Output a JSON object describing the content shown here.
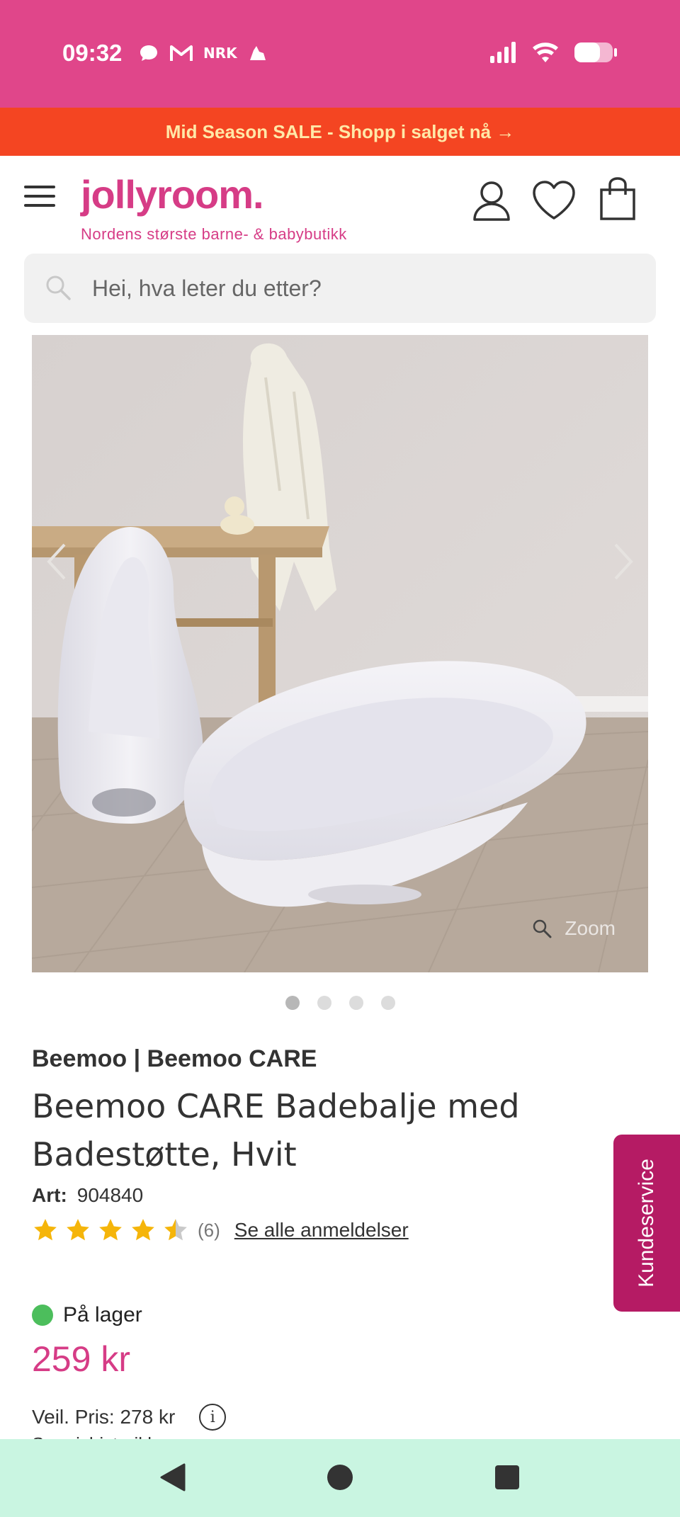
{
  "status_bar": {
    "time": "09:32",
    "notification_icons": [
      "chat-bubble-icon",
      "gmail-icon",
      "nrk-icon",
      "cloud-icon"
    ],
    "nrk_label": "NRK",
    "system_icons": [
      "signal-icon",
      "wifi-icon",
      "battery-icon"
    ]
  },
  "sale_banner": {
    "text": "Mid Season SALE - Shopp i salget nå →"
  },
  "header": {
    "logo": "jollyroom.",
    "tagline": "Nordens største barne- & babybutikk",
    "icons": [
      "menu-icon",
      "account-icon",
      "heart-icon",
      "bag-icon"
    ]
  },
  "search": {
    "placeholder": "Hei, hva leter du etter?"
  },
  "gallery": {
    "zoom_label": "Zoom",
    "current_slide": 1,
    "slide_count": 4
  },
  "product": {
    "brand": "Beemoo | Beemoo CARE",
    "title": "Beemoo CARE Badebalje med Badestøtte, Hvit",
    "art_label": "Art:",
    "art_number": "904840",
    "rating": 4.5,
    "rating_max": 5,
    "review_count": "(6)",
    "reviews_link": "Se alle anmeldelser",
    "stock": "På lager",
    "price": "259 kr",
    "recommended_price": "Veil. Pris: 278 kr",
    "price_history": "Se prishistorikk"
  },
  "customer_service": {
    "label": "Kundeservice"
  },
  "colors": {
    "status_bar": "#e0468a",
    "sale_banner": "#f44522",
    "sale_text": "#ffe8a8",
    "brand_pink": "#d63c86",
    "kundeservice": "#b51b64",
    "in_stock": "#4cbe5c",
    "nav_bar": "#c9f5e1"
  }
}
